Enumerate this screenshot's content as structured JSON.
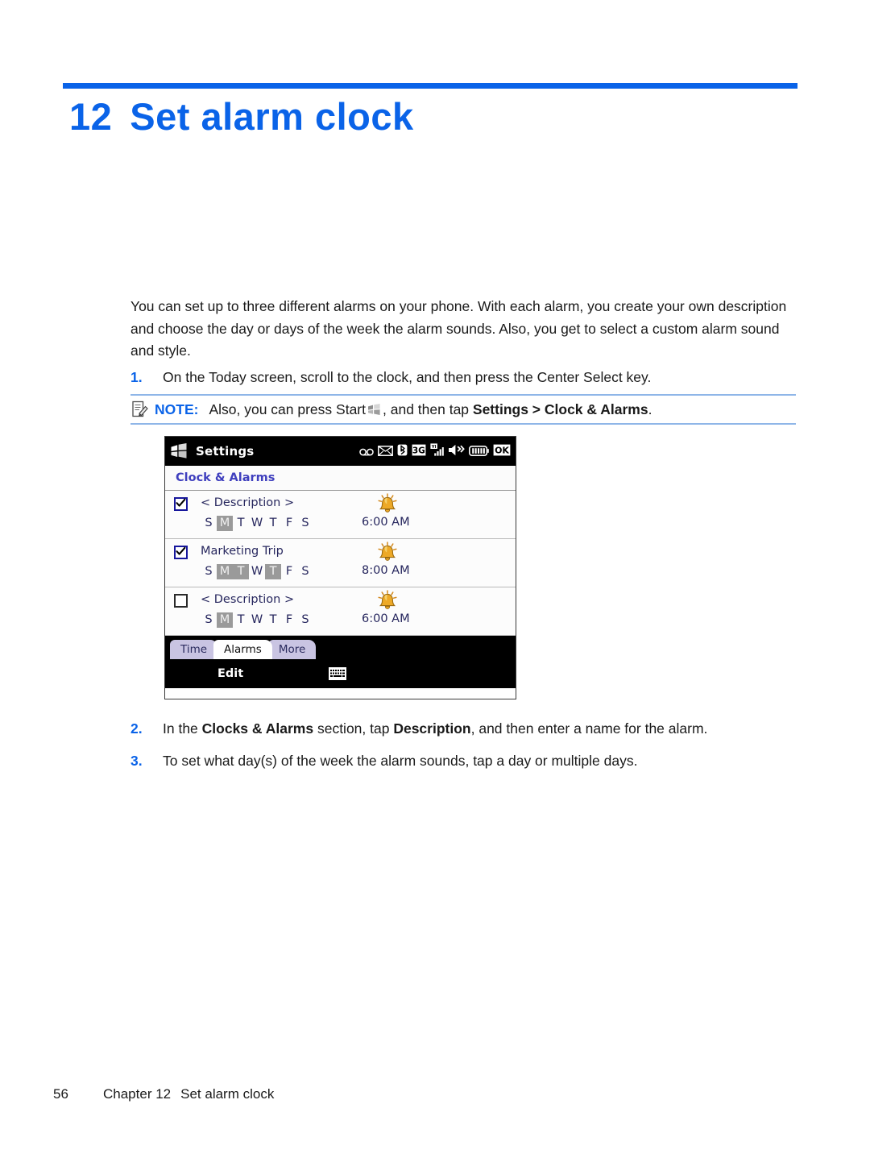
{
  "colors": {
    "accent_blue": "#0a63e8",
    "note_rule": "#8fb6e8",
    "device_section_text": "#3f3fbe",
    "device_list_text": "#27275e",
    "day_selected_bg": "#9a9a9a",
    "bell_gold": "#e8a41e",
    "black": "#000000"
  },
  "header": {
    "chapter_number": "12",
    "chapter_title": "Set alarm clock"
  },
  "intro": {
    "paragraph": "You can set up to three different alarms on your phone. With each alarm, you create your own description and choose the day or days of the week the alarm sounds. Also, you get to select a custom alarm sound and style."
  },
  "steps": [
    {
      "number": "1.",
      "text": "On the Today screen, scroll to the clock, and then press the Center Select key."
    },
    {
      "number": "2.",
      "parts": [
        {
          "t": "In the ",
          "bold": false
        },
        {
          "t": "Clocks & Alarms",
          "bold": true
        },
        {
          "t": " section, tap ",
          "bold": false
        },
        {
          "t": "Description",
          "bold": true
        },
        {
          "t": ", and then enter a name for the alarm.",
          "bold": false
        }
      ]
    },
    {
      "number": "3.",
      "text": "To set what day(s) of the week the alarm sounds, tap a day or multiple days."
    }
  ],
  "note": {
    "icon": "note-pencil-icon",
    "label": "NOTE:",
    "text_before_icon": "Also, you can press Start",
    "inline_icon": "windows-start-icon",
    "text_after_icon": ", and then tap ",
    "bold_path": "Settings > Clock & Alarms",
    "text_end": "."
  },
  "device": {
    "titlebar": {
      "start_icon": "windows-start-icon",
      "title": "Settings",
      "status_icons": [
        "voicemail-icon",
        "envelope-icon",
        "bluetooth-icon",
        "3g-icon",
        "signal-bars-icon",
        "speaker-icon",
        "battery-icon",
        "ok-icon"
      ]
    },
    "section_header": "Clock & Alarms",
    "day_letters": [
      "S",
      "M",
      "T",
      "W",
      "T",
      "F",
      "S"
    ],
    "alarms": [
      {
        "checked": true,
        "description": "< Description >",
        "days_selected": [
          false,
          true,
          false,
          false,
          false,
          false,
          false
        ],
        "alarm_icon": "alarm-bell-icon",
        "time": "6:00 AM"
      },
      {
        "checked": true,
        "description": "Marketing Trip",
        "days_selected": [
          false,
          true,
          true,
          false,
          true,
          false,
          false
        ],
        "alarm_icon": "alarm-bell-icon",
        "time": "8:00 AM"
      },
      {
        "checked": false,
        "description": "< Description >",
        "days_selected": [
          false,
          true,
          false,
          false,
          false,
          false,
          false
        ],
        "alarm_icon": "alarm-bell-icon",
        "time": "6:00 AM"
      }
    ],
    "tabs": [
      {
        "label": "Time",
        "active": false
      },
      {
        "label": "Alarms",
        "active": true
      },
      {
        "label": "More",
        "active": false
      }
    ],
    "softkeys": {
      "left_label": "Edit",
      "keyboard_icon": "keyboard-icon"
    }
  },
  "footer": {
    "page_number": "56",
    "chapter": "Chapter 12",
    "title": "Set alarm clock"
  }
}
